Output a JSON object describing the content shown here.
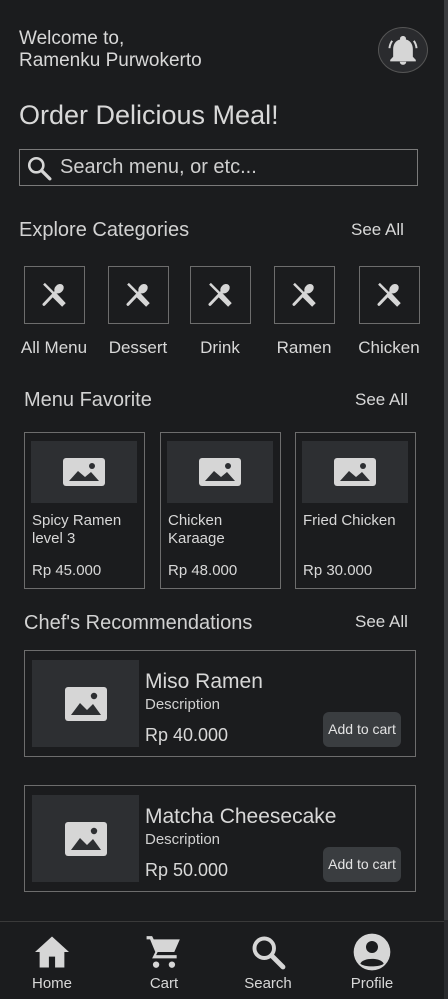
{
  "header": {
    "welcome_line1": "Welcome to,",
    "welcome_line2": "Ramenku Purwokerto",
    "title": "Order Delicious Meal!"
  },
  "search": {
    "placeholder": "Search menu, or etc..."
  },
  "categories": {
    "title": "Explore Categories",
    "see_all": "See All",
    "items": [
      {
        "label": "All Menu",
        "icon": "utensils-icon"
      },
      {
        "label": "Dessert",
        "icon": "utensils-icon"
      },
      {
        "label": "Drink",
        "icon": "utensils-icon"
      },
      {
        "label": "Ramen",
        "icon": "utensils-icon"
      },
      {
        "label": "Chicken",
        "icon": "utensils-icon"
      }
    ]
  },
  "favorites": {
    "title": "Menu Favorite",
    "see_all": "See All",
    "items": [
      {
        "name": "Spicy Ramen level 3",
        "price": "Rp 45.000"
      },
      {
        "name": "Chicken Karaage",
        "price": "Rp 48.000"
      },
      {
        "name": "Fried Chicken",
        "price": "Rp 30.000"
      }
    ]
  },
  "recommendations": {
    "title": "Chef's Recommendations",
    "see_all": "See All",
    "items": [
      {
        "name": "Miso Ramen",
        "description": "Description",
        "price": "Rp 40.000",
        "button": "Add to cart"
      },
      {
        "name": "Matcha Cheesecake",
        "description": "Description",
        "price": "Rp 50.000",
        "button": "Add to cart"
      }
    ]
  },
  "nav": {
    "items": [
      {
        "label": "Home",
        "icon": "home-icon"
      },
      {
        "label": "Cart",
        "icon": "cart-icon"
      },
      {
        "label": "Search",
        "icon": "search-icon"
      },
      {
        "label": "Profile",
        "icon": "profile-icon"
      }
    ]
  },
  "colors": {
    "background": "#1b1c1e",
    "card_border": "#6d6d6d",
    "image_placeholder": "#2d2f32",
    "button": "#3a3d40",
    "text": "#d8d8d8"
  }
}
